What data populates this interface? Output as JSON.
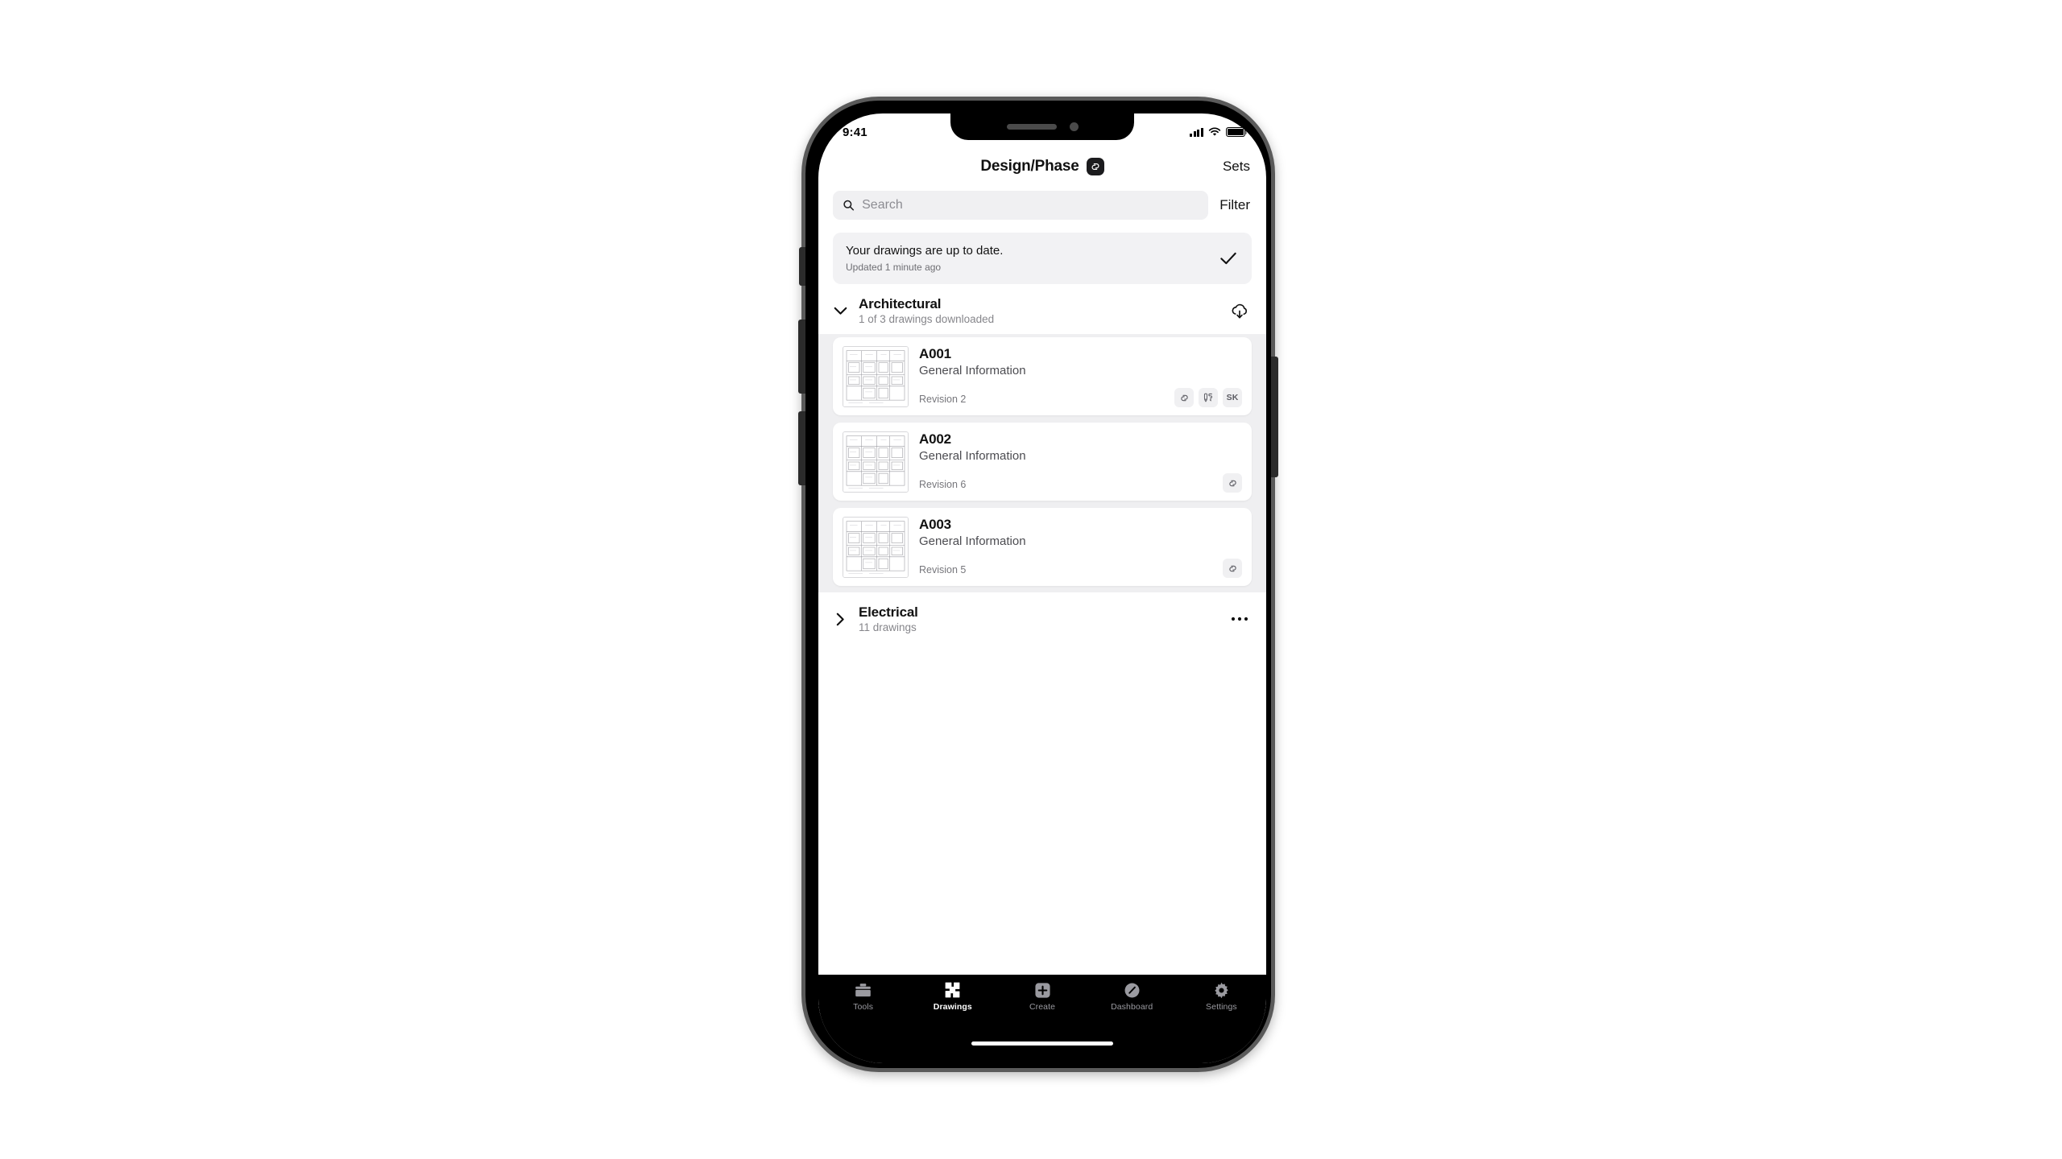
{
  "status_bar": {
    "time": "9:41",
    "cellular_icon": "signal-bars-icon",
    "wifi_icon": "wifi-icon",
    "battery_icon": "battery-full-icon"
  },
  "header": {
    "title": "Design/Phase",
    "logo_icon": "app-logo-icon",
    "sets_label": "Sets"
  },
  "search": {
    "placeholder": "Search",
    "value": "",
    "icon": "search-icon",
    "filter_label": "Filter"
  },
  "sync_card": {
    "title": "Your drawings are up to date.",
    "subtitle": "Updated 1 minute ago",
    "status_icon": "checkmark-icon"
  },
  "sections": [
    {
      "title": "Architectural",
      "subtitle": "1 of 3 drawings downloaded",
      "expanded": true,
      "chevron_icon": "chevron-down-icon",
      "action_icon": "cloud-download-icon",
      "drawings": [
        {
          "number": "A001",
          "description": "General Information",
          "revision": "Revision 2",
          "thumbnail": "floor-plan-thumbnail",
          "badges": [
            {
              "type": "icon",
              "name": "linked-sheets-icon",
              "label": ""
            },
            {
              "type": "icon",
              "name": "markup-pencil-icon",
              "label": ""
            },
            {
              "type": "text",
              "name": "sketch-badge",
              "label": "SK"
            }
          ]
        },
        {
          "number": "A002",
          "description": "General Information",
          "revision": "Revision 6",
          "thumbnail": "floor-plan-thumbnail",
          "badges": [
            {
              "type": "icon",
              "name": "linked-sheets-icon",
              "label": ""
            }
          ]
        },
        {
          "number": "A003",
          "description": "General Information",
          "revision": "Revision 5",
          "thumbnail": "floor-plan-thumbnail",
          "badges": [
            {
              "type": "icon",
              "name": "linked-sheets-icon",
              "label": ""
            }
          ]
        }
      ]
    },
    {
      "title": "Electrical",
      "subtitle": "11 drawings",
      "expanded": false,
      "chevron_icon": "chevron-right-icon",
      "action_icon": "more-options-icon",
      "drawings": []
    }
  ],
  "tab_bar": {
    "items": [
      {
        "label": "Tools",
        "icon": "toolbox-icon",
        "active": false
      },
      {
        "label": "Drawings",
        "icon": "drawings-icon",
        "active": true
      },
      {
        "label": "Create",
        "icon": "plus-square-icon",
        "active": false
      },
      {
        "label": "Dashboard",
        "icon": "gauge-icon",
        "active": false
      },
      {
        "label": "Settings",
        "icon": "gear-icon",
        "active": false
      }
    ]
  },
  "colors": {
    "accent_dark": "#1c1c1e",
    "page_background": "#ffffff",
    "list_background": "#efeff1",
    "card_fill": "#f2f2f4",
    "tabbar_background": "#000000",
    "tab_active": "#ffffff",
    "tab_inactive": "#9a9aa0"
  }
}
